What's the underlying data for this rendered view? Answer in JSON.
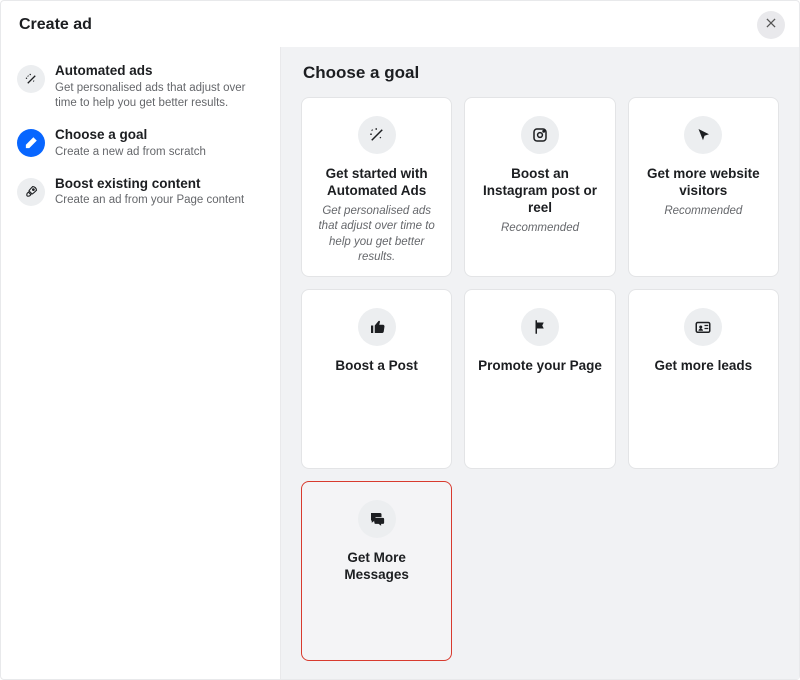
{
  "header": {
    "title": "Create ad"
  },
  "sidebar": {
    "items": [
      {
        "title": "Automated ads",
        "sub": "Get personalised ads that adjust over time to help you get better results."
      },
      {
        "title": "Choose a goal",
        "sub": "Create a new ad from scratch"
      },
      {
        "title": "Boost existing content",
        "sub": "Create an ad from your Page content"
      }
    ],
    "selectedIndex": 1
  },
  "main": {
    "heading": "Choose a goal",
    "goals": [
      {
        "title": "Get started with Automated Ads",
        "desc": "Get personalised ads that adjust over time to help you get better results.",
        "icon": "wand"
      },
      {
        "title": "Boost an Instagram post or reel",
        "desc": "Recommended",
        "icon": "instagram"
      },
      {
        "title": "Get more website visitors",
        "desc": "Recommended",
        "icon": "cursor"
      },
      {
        "title": "Boost a Post",
        "desc": "",
        "icon": "like"
      },
      {
        "title": "Promote your Page",
        "desc": "",
        "icon": "flag"
      },
      {
        "title": "Get more leads",
        "desc": "",
        "icon": "idcard"
      },
      {
        "title": "Get More Messages",
        "desc": "",
        "icon": "chat",
        "highlight": true
      }
    ]
  },
  "colors": {
    "accent": "#0866ff",
    "highlightBorder": "#d83a2e"
  }
}
